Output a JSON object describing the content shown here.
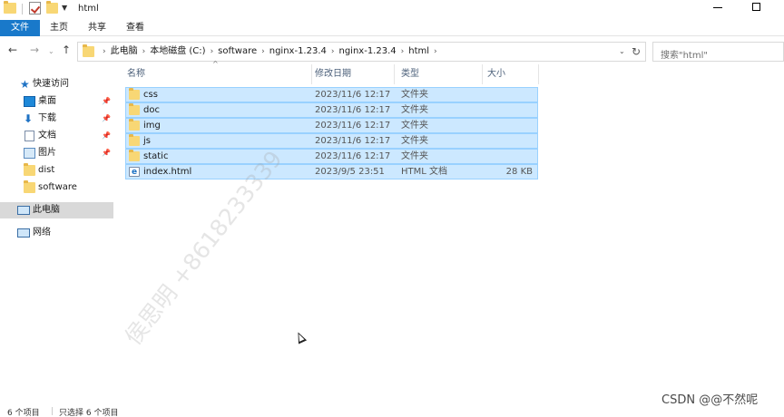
{
  "window": {
    "title": "html"
  },
  "ribbon": {
    "tabs": [
      "文件",
      "主页",
      "共享",
      "查看"
    ]
  },
  "address": {
    "crumbs": [
      "此电脑",
      "本地磁盘 (C:)",
      "software",
      "nginx-1.23.4",
      "nginx-1.23.4",
      "html"
    ],
    "search_placeholder": "搜索\"html\""
  },
  "sidebar": {
    "quick_access": "快速访问",
    "items": [
      {
        "label": "桌面",
        "icon": "desktop-icon",
        "pinned": true
      },
      {
        "label": "下载",
        "icon": "download-icon",
        "pinned": true
      },
      {
        "label": "文档",
        "icon": "documents-icon",
        "pinned": true
      },
      {
        "label": "图片",
        "icon": "pictures-icon",
        "pinned": true
      },
      {
        "label": "dist",
        "icon": "folder-icon",
        "pinned": false
      },
      {
        "label": "software",
        "icon": "folder-icon",
        "pinned": false
      }
    ],
    "this_pc": "此电脑",
    "network": "网络"
  },
  "columns": {
    "name": "名称",
    "date": "修改日期",
    "type": "类型",
    "size": "大小"
  },
  "files": [
    {
      "name": "css",
      "date": "2023/11/6 12:17",
      "type": "文件夹",
      "size": "",
      "icon": "folder-icon"
    },
    {
      "name": "doc",
      "date": "2023/11/6 12:17",
      "type": "文件夹",
      "size": "",
      "icon": "folder-icon"
    },
    {
      "name": "img",
      "date": "2023/11/6 12:17",
      "type": "文件夹",
      "size": "",
      "icon": "folder-icon"
    },
    {
      "name": "js",
      "date": "2023/11/6 12:17",
      "type": "文件夹",
      "size": "",
      "icon": "folder-icon"
    },
    {
      "name": "static",
      "date": "2023/11/6 12:17",
      "type": "文件夹",
      "size": "",
      "icon": "folder-icon"
    },
    {
      "name": "index.html",
      "date": "2023/9/5 23:51",
      "type": "HTML 文档",
      "size": "28 KB",
      "icon": "html-file-icon"
    }
  ],
  "status": {
    "count": "6 个项目",
    "selected": "只选择 6 个项目"
  },
  "watermark": "侯思明 +8618233339",
  "csdn": "CSDN @@不然呢",
  "colors": {
    "accent": "#1979ca",
    "selection": "#cce8ff",
    "selection_border": "#99d1ff"
  }
}
